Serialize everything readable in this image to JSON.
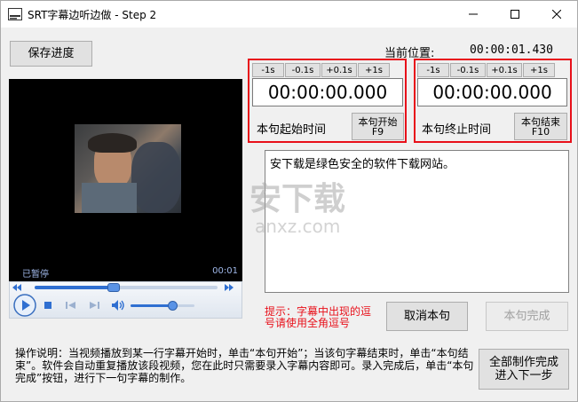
{
  "window": {
    "title": "SRT字幕边听边做 - Step 2"
  },
  "toolbar": {
    "save_label": "保存进度"
  },
  "position": {
    "label": "当前位置:",
    "value": "00:00:01.430"
  },
  "start": {
    "steps": [
      "-1s",
      "-0.1s",
      "+0.1s",
      "+1s"
    ],
    "time": "00:00:00.000",
    "label": "本句起始时间",
    "button_line1": "本句开始",
    "button_line2": "F9"
  },
  "end": {
    "steps": [
      "-1s",
      "-0.1s",
      "+0.1s",
      "+1s"
    ],
    "time": "00:00:00.000",
    "label": "本句终止时间",
    "button_line1": "本句结束",
    "button_line2": "F10"
  },
  "subtitle_text": "安下载是绿色安全的软件下载网站。",
  "player": {
    "status": "已暂停",
    "time": "00:01",
    "progress": 0.43,
    "volume": 0.65
  },
  "hint": "提示：字幕中出现的逗号请使用全角逗号",
  "actions": {
    "cancel_label": "取消本句",
    "done_label": "本句完成",
    "finish_line1": "全部制作完成",
    "finish_line2": "进入下一步"
  },
  "instructions": "操作说明：当视频播放到某一行字幕开始时，单击“本句开始”；当该句字幕结束时，单击“本句结束”。软件会自动重复播放该段视频，您在此时只需要录入字幕内容即可。录入完成后，单击“本句完成”按钮，进行下一句字幕的制作。",
  "watermark": {
    "text": "安下载",
    "sub": "anxz.com"
  }
}
